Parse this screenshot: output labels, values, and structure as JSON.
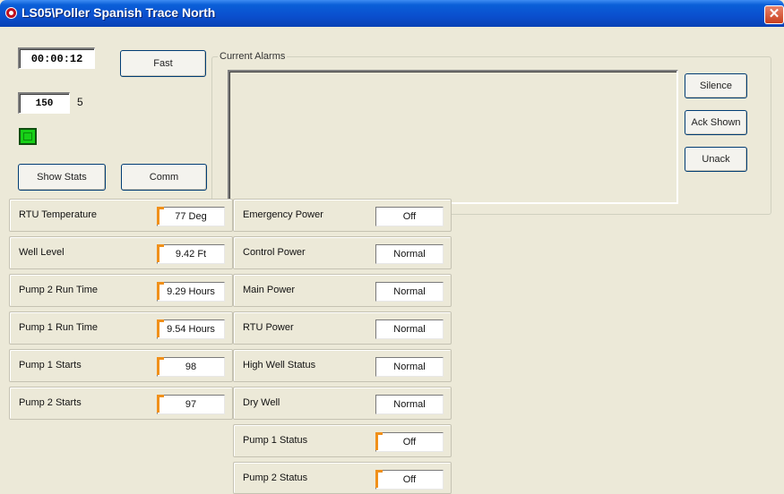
{
  "window": {
    "title": "LS05\\Poller Spanish Trace North",
    "close_symbol": "✕"
  },
  "controls": {
    "timer": "00:00:12",
    "fast_label": "Fast",
    "count_value": "150",
    "count_suffix": "5",
    "status_led_color": "#18d018",
    "show_stats_label": "Show Stats",
    "comm_label": "Comm"
  },
  "alarms": {
    "title": "Current Alarms",
    "silence_label": "Silence",
    "ack_label": "Ack Shown",
    "unack_label": "Unack"
  },
  "measurements": [
    {
      "label": "RTU Temperature",
      "value": "77 Deg"
    },
    {
      "label": "Well Level",
      "value": "9.42 Ft"
    },
    {
      "label": "Pump 2 Run Time",
      "value": "9.29 Hours"
    },
    {
      "label": "Pump 1 Run Time",
      "value": "9.54 Hours"
    },
    {
      "label": "Pump 1 Starts",
      "value": "98"
    },
    {
      "label": "Pump 2 Starts",
      "value": "97"
    }
  ],
  "statuses": [
    {
      "label": "Emergency Power",
      "value": "Off"
    },
    {
      "label": "Control Power",
      "value": "Normal"
    },
    {
      "label": "Main Power",
      "value": "Normal"
    },
    {
      "label": "RTU Power",
      "value": "Normal"
    },
    {
      "label": "High Well Status",
      "value": "Normal"
    },
    {
      "label": "Dry Well",
      "value": "Normal"
    },
    {
      "label": "Pump 1 Status",
      "value": "Off"
    },
    {
      "label": "Pump 2 Status",
      "value": "Off"
    }
  ],
  "colors": {
    "titlebar": "#0a4fce",
    "indicator_mark": "#f0901a",
    "window_bg": "#ece9d8"
  }
}
